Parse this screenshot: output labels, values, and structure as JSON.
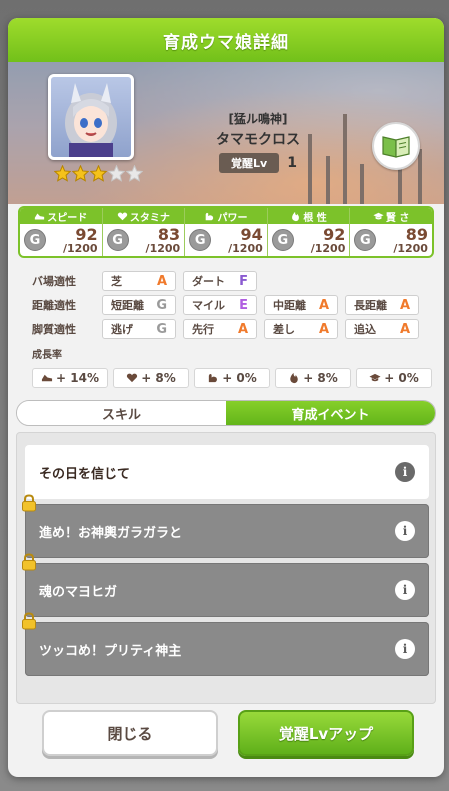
{
  "dialog": {
    "title": "育成ウマ娘詳細",
    "accent": "#7cc22a"
  },
  "character": {
    "epithet": "[猛ル鳴神]",
    "name": "タマモクロス",
    "awakening_label": "覚醒Lv",
    "awakening_level": "1",
    "stars": 3,
    "max_stars": 5
  },
  "stats": [
    {
      "label": "スピード",
      "icon": "shoe-icon",
      "grade": "G",
      "value": "92",
      "max": "/1200"
    },
    {
      "label": "スタミナ",
      "icon": "heart-icon",
      "grade": "G",
      "value": "83",
      "max": "/1200"
    },
    {
      "label": "パワー",
      "icon": "muscle-icon",
      "grade": "G",
      "value": "94",
      "max": "/1200"
    },
    {
      "label": "根 性",
      "icon": "flame-icon",
      "grade": "G",
      "value": "92",
      "max": "/1200"
    },
    {
      "label": "賢 さ",
      "icon": "graduation-cap-icon",
      "grade": "G",
      "value": "89",
      "max": "/1200"
    }
  ],
  "aptitudes": {
    "track": {
      "label": "バ場適性",
      "cells": [
        {
          "name": "芝",
          "grade": "A"
        },
        {
          "name": "ダート",
          "grade": "F"
        }
      ]
    },
    "distance": {
      "label": "距離適性",
      "cells": [
        {
          "name": "短距離",
          "grade": "G"
        },
        {
          "name": "マイル",
          "grade": "E"
        },
        {
          "name": "中距離",
          "grade": "A"
        },
        {
          "name": "長距離",
          "grade": "A"
        }
      ]
    },
    "style": {
      "label": "脚質適性",
      "cells": [
        {
          "name": "逃げ",
          "grade": "G"
        },
        {
          "name": "先行",
          "grade": "A"
        },
        {
          "name": "差し",
          "grade": "A"
        },
        {
          "name": "追込",
          "grade": "A"
        }
      ]
    }
  },
  "growth": {
    "title": "成長率",
    "rates": [
      {
        "icon": "shoe-icon",
        "value": "+ 14%"
      },
      {
        "icon": "heart-icon",
        "value": "+ 8%"
      },
      {
        "icon": "muscle-icon",
        "value": "+ 0%"
      },
      {
        "icon": "flame-icon",
        "value": "+ 8%"
      },
      {
        "icon": "graduation-cap-icon",
        "value": "+ 0%"
      }
    ]
  },
  "tabs": {
    "skill": "スキル",
    "events": "育成イベント",
    "active": "events"
  },
  "events": [
    {
      "title": "その日を信じて",
      "locked": false
    },
    {
      "title": "進め！お神輿ガラガラと",
      "locked": true
    },
    {
      "title": "魂のマヨヒガ",
      "locked": true
    },
    {
      "title": "ツッコめ！プリティ神主",
      "locked": true
    }
  ],
  "info_glyph": "i",
  "buttons": {
    "close": "閉じる",
    "awaken": "覚醒Lvアップ"
  },
  "grade_colors": {
    "A": "#f07a2c",
    "E": "#b05ee0",
    "F": "#8a5ad0",
    "G": "#9a9a9a"
  }
}
